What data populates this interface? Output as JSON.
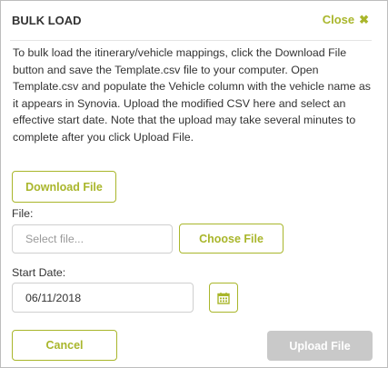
{
  "dialog": {
    "title": "BULK LOAD",
    "close_label": "Close",
    "description": "To bulk load the itinerary/vehicle mappings, click the Download File button and save the Template.csv file to your computer. Open Template.csv and populate the Vehicle column with the vehicle name as it appears in Synovia. Upload the modified CSV here and select an effective start date. Note that the upload may take several minutes to complete after you click Upload File.",
    "download_button": "Download File",
    "file_label": "File:",
    "file_placeholder": "Select file...",
    "choose_button": "Choose File",
    "start_date_label": "Start Date:",
    "start_date_value": "06/11/2018",
    "cancel_button": "Cancel",
    "upload_button": "Upload File"
  },
  "colors": {
    "accent": "#a9b62b",
    "disabled": "#c9c9c9"
  },
  "icons": {
    "close": "close-x-icon",
    "calendar": "calendar-icon"
  }
}
